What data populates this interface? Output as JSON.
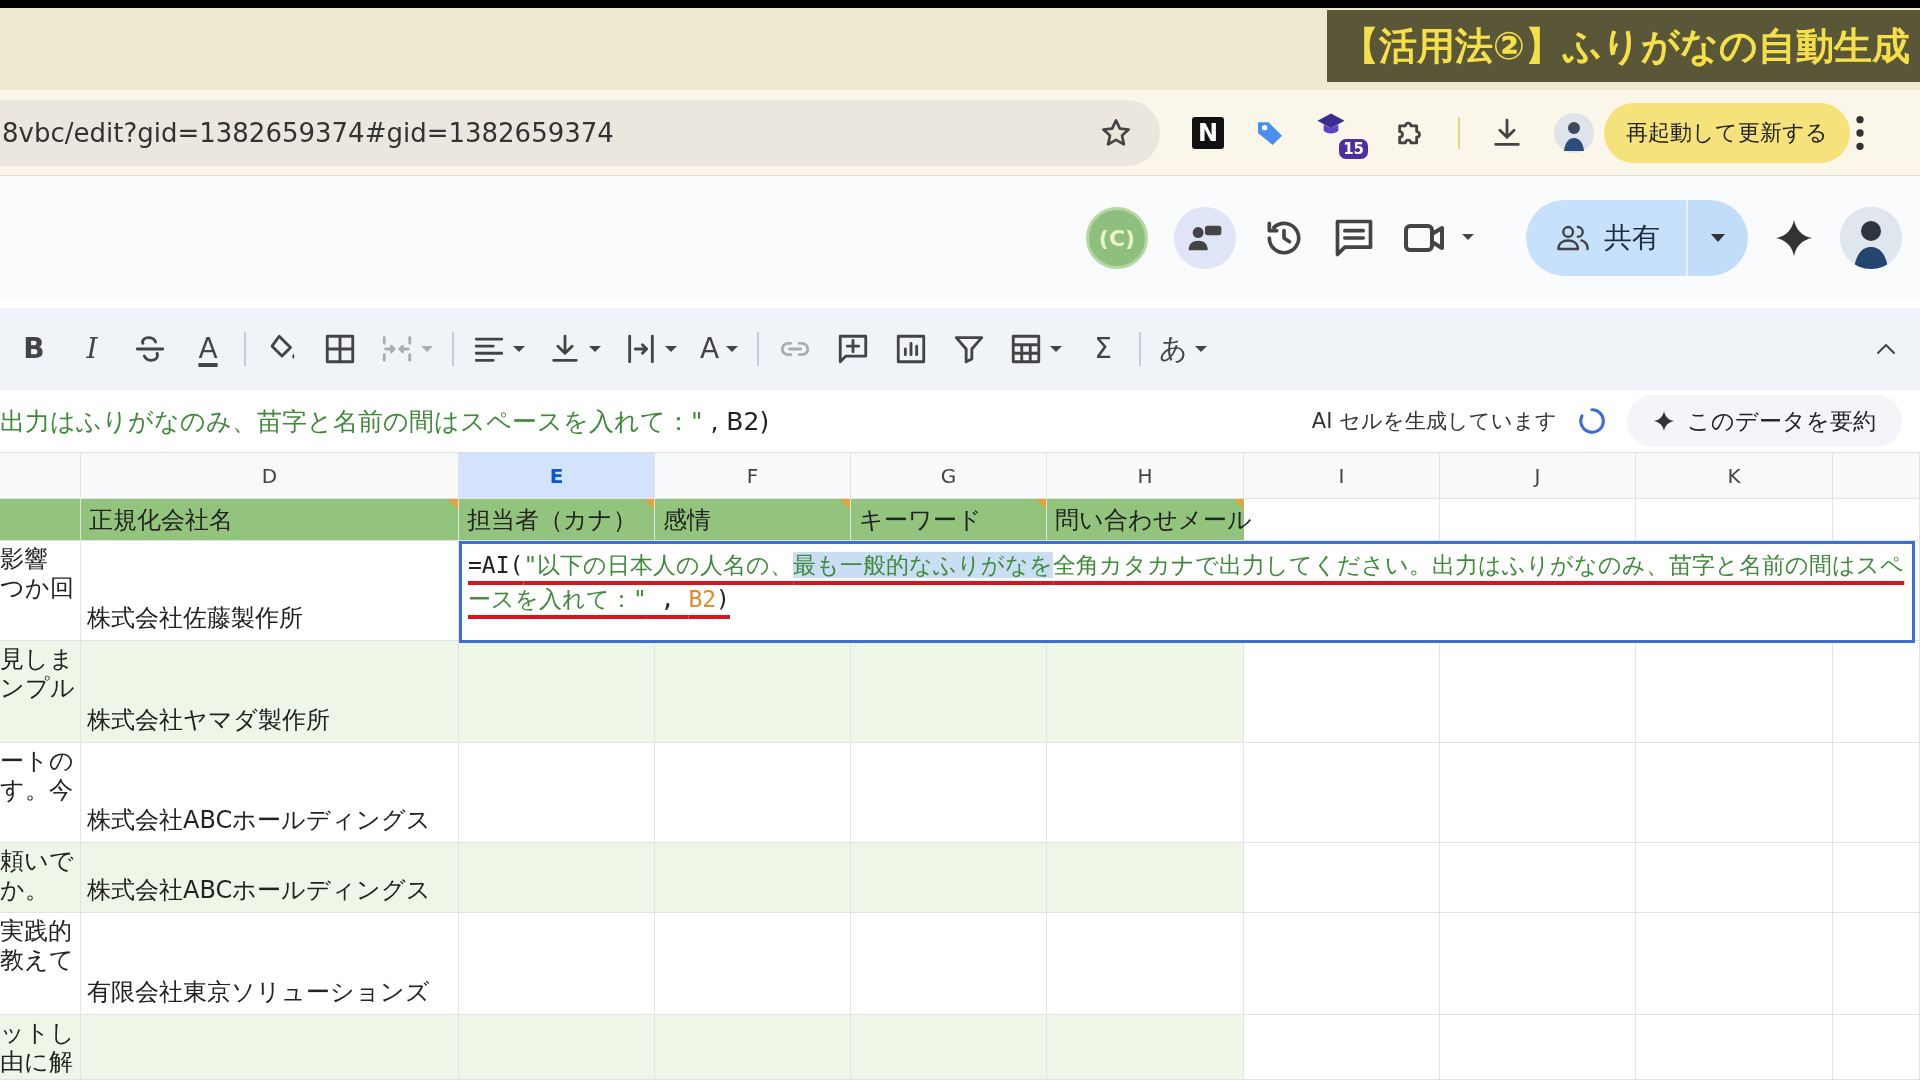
{
  "video_title": "【活用法②】ふりがなの自動生成",
  "browser": {
    "url": "8vbc/edit?gid=1382659374#gid=1382659374",
    "extension_letter": "N",
    "extension_badge": "15",
    "update_button": "再起動して更新する"
  },
  "sheets_header": {
    "presence_avatar": "(C)",
    "share_button": "共有"
  },
  "toolbar": [
    {
      "kind": "bold",
      "text": "B",
      "disabled": false,
      "dropdown": false
    },
    {
      "kind": "italic",
      "text": "I",
      "disabled": false,
      "dropdown": false
    },
    {
      "kind": "strikethrough",
      "disabled": false,
      "dropdown": false
    },
    {
      "kind": "text_color",
      "text": "A",
      "disabled": false,
      "dropdown": false
    },
    {
      "kind": "separator"
    },
    {
      "kind": "fill",
      "disabled": false,
      "dropdown": false
    },
    {
      "kind": "borders",
      "disabled": false,
      "dropdown": false
    },
    {
      "kind": "merge",
      "disabled": true,
      "dropdown": true
    },
    {
      "kind": "separator"
    },
    {
      "kind": "align",
      "disabled": false,
      "dropdown": true
    },
    {
      "kind": "valign",
      "disabled": false,
      "dropdown": true
    },
    {
      "kind": "wrap",
      "disabled": false,
      "dropdown": true
    },
    {
      "kind": "rotate",
      "text": "A",
      "disabled": false,
      "dropdown": true
    },
    {
      "kind": "separator"
    },
    {
      "kind": "link",
      "disabled": true,
      "dropdown": false
    },
    {
      "kind": "comment",
      "disabled": false,
      "dropdown": false
    },
    {
      "kind": "chart",
      "disabled": false,
      "dropdown": false
    },
    {
      "kind": "filter",
      "disabled": false,
      "dropdown": false
    },
    {
      "kind": "table",
      "disabled": false,
      "dropdown": true
    },
    {
      "kind": "sum",
      "text": "Σ",
      "disabled": false,
      "dropdown": false
    },
    {
      "kind": "separator"
    },
    {
      "kind": "input_tools",
      "text": "あ",
      "disabled": false,
      "dropdown": true
    }
  ],
  "formula_bar": {
    "segments": [
      {
        "kind": "string",
        "text": "出力はふりがなのみ、苗字と名前の間はスペースを入れて：\""
      },
      {
        "kind": "plain",
        "text": " , B2)"
      }
    ],
    "status": "AI セルを生成しています",
    "summarize_button": "このデータを要約"
  },
  "grid": {
    "columns": [
      {
        "selected": false
      },
      {
        "letter": "D",
        "selected": false
      },
      {
        "letter": "E",
        "selected": true
      },
      {
        "letter": "F",
        "selected": false
      },
      {
        "letter": "G",
        "selected": false
      },
      {
        "letter": "H",
        "selected": false
      },
      {
        "letter": "I",
        "selected": false
      },
      {
        "letter": "J",
        "selected": false
      },
      {
        "letter": "K",
        "selected": false
      },
      {
        "selected": false
      }
    ],
    "header_row": [
      {
        "note": false
      },
      {
        "text": "正規化会社名",
        "note": true
      },
      {
        "text": "担当者（カナ）",
        "note": true
      },
      {
        "text": "感情",
        "note": true
      },
      {
        "text": "キーワード",
        "note": true
      },
      {
        "text": "問い合わせメール",
        "note": true
      }
    ],
    "rows": [
      {
        "banded": false,
        "c": [
          "影響",
          "つか回"
        ],
        "d": "株式会社佐藤製作所"
      },
      {
        "banded": true,
        "c": [
          "見しま",
          "ンプル"
        ],
        "d": "株式会社ヤマダ製作所"
      },
      {
        "banded": false,
        "c": [
          "ートの",
          "す。今"
        ],
        "d": "株式会社ABCホールディングス"
      },
      {
        "banded": true,
        "c": [
          "頼いで",
          "か。"
        ],
        "d": "株式会社ABCホールディングス"
      },
      {
        "banded": false,
        "c": [
          "実践的",
          "教えて"
        ],
        "d": "有限会社東京ソリューションズ"
      },
      {
        "banded": true,
        "c": [
          "ットし",
          "由に解"
        ]
      }
    ]
  },
  "editor": {
    "annotated": true,
    "segments": [
      {
        "kind": "function",
        "text": "=AI(",
        "highlighted": false
      },
      {
        "kind": "string",
        "text": "\"以下の日本人の人名の、",
        "highlighted": false
      },
      {
        "kind": "string",
        "text": "最も一般的なふりがなを",
        "highlighted": true
      },
      {
        "kind": "string",
        "text": "全角カタカナで出力してください。出力はふりがなのみ、苗字と名前の間はスペースを入れて：\"",
        "highlighted": false
      },
      {
        "kind": "plain",
        "text": " , ",
        "highlighted": false
      },
      {
        "kind": "reference",
        "text": "B2",
        "highlighted": false
      },
      {
        "kind": "plain",
        "text": ")",
        "highlighted": false
      }
    ]
  }
}
